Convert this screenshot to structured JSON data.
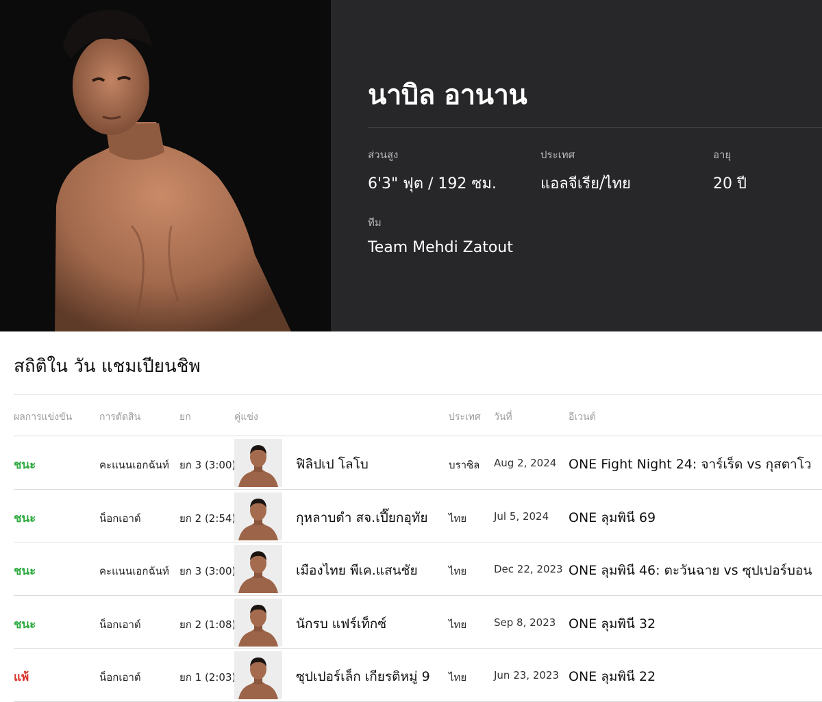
{
  "fighter": {
    "name": "นาบิล อานาน",
    "height_label": "ส่วนสูง",
    "height_value": "6'3\" ฟุต / 192 ซม.",
    "country_label": "ประเทศ",
    "country_value": "แอลจีเรีย/ไทย",
    "age_label": "อายุ",
    "age_value": "20 ปี",
    "team_label": "ทีม",
    "team_value": "Team Mehdi Zatout"
  },
  "stats": {
    "title": "สถิติใน วัน แชมเปียนชิพ",
    "headers": {
      "result": "ผลการแข่งขัน",
      "method": "การตัดสิน",
      "round": "ยก",
      "opponent": "คู่แข่ง",
      "country": "ประเทศ",
      "date": "วันที่",
      "event": "อีเวนต์"
    },
    "rows": [
      {
        "result": "ชนะ",
        "method": "คะแนนเอกฉันท์",
        "round": "ยก 3 (3:00)",
        "opponent": "ฟิลิปเป โลโบ",
        "country": "บราซิล",
        "date": "Aug 2, 2024",
        "event": "ONE Fight Night 24: จาร์เร็ด vs กุสตาโว"
      },
      {
        "result": "ชนะ",
        "method": "น็อกเอาต์",
        "round": "ยก 2 (2:54)",
        "opponent": "กุหลาบดำ สจ.เปี๊ยกอุทัย",
        "country": "ไทย",
        "date": "Jul 5, 2024",
        "event": "ONE ลุมพินี 69"
      },
      {
        "result": "ชนะ",
        "method": "คะแนนเอกฉันท์",
        "round": "ยก 3 (3:00)",
        "opponent": "เมืองไทย พีเค.แสนชัย",
        "country": "ไทย",
        "date": "Dec 22, 2023",
        "event": "ONE ลุมพินี 46: ตะวันฉาย vs ซุปเปอร์บอน"
      },
      {
        "result": "ชนะ",
        "method": "น็อกเอาต์",
        "round": "ยก 2 (1:08)",
        "opponent": "นักรบ แฟร์เท็กซ์",
        "country": "ไทย",
        "date": "Sep 8, 2023",
        "event": "ONE ลุมพินี 32"
      },
      {
        "result": "แพ้",
        "method": "น็อกเอาต์",
        "round": "ยก 1 (2:03)",
        "opponent": "ซุปเปอร์เล็ก เกียรติหมู่ 9",
        "country": "ไทย",
        "date": "Jun 23, 2023",
        "event": "ONE ลุมพินี 22"
      }
    ]
  },
  "colors": {
    "win": "#2eaa3f",
    "loss": "#d9342b",
    "hero_info_bg": "#27272a",
    "hero_photo_bg": "#0b0b0b"
  }
}
